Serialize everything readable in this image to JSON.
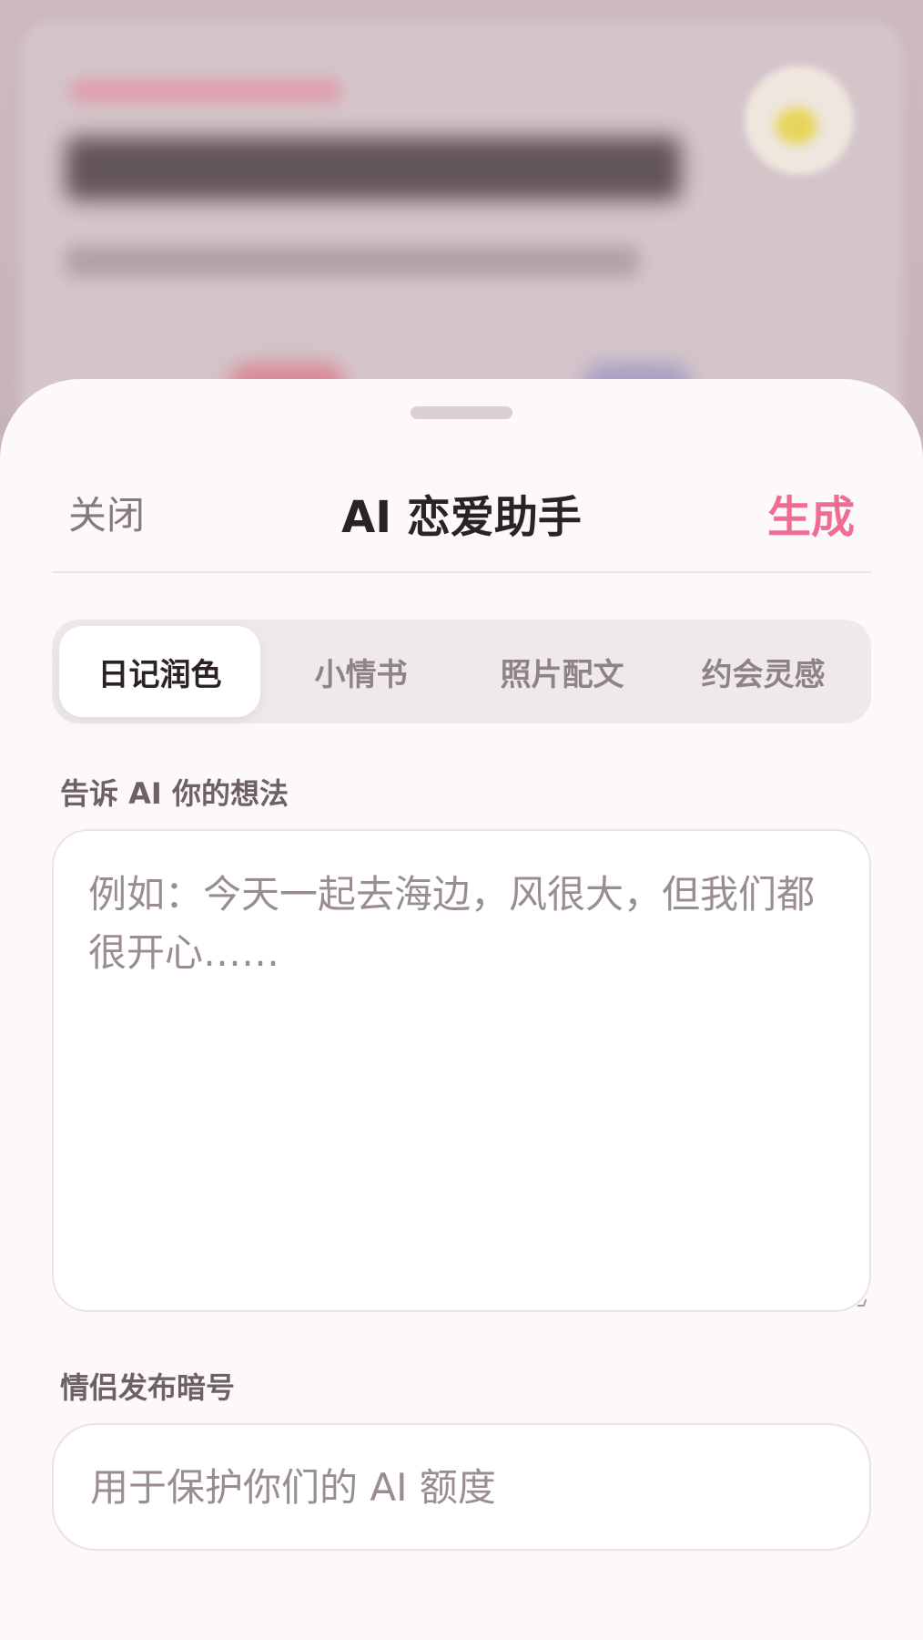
{
  "header": {
    "close_label": "关闭",
    "title": "AI 恋爱助手",
    "generate_label": "生成"
  },
  "tabs": [
    {
      "label": "日记润色",
      "active": true
    },
    {
      "label": "小情书",
      "active": false
    },
    {
      "label": "照片配文",
      "active": false
    },
    {
      "label": "约会灵感",
      "active": false
    }
  ],
  "thoughts": {
    "label": "告诉 AI 你的想法",
    "value": "",
    "placeholder": "例如：今天一起去海边，风很大，但我们都很开心……"
  },
  "passcode": {
    "label": "情侣发布暗号",
    "value": "",
    "placeholder": "用于保护你们的 AI 额度"
  },
  "colors": {
    "accent": "#f06c93",
    "sheet_background": "#fdf8fa",
    "title_text": "#2b2226",
    "muted_text": "#85797e"
  }
}
